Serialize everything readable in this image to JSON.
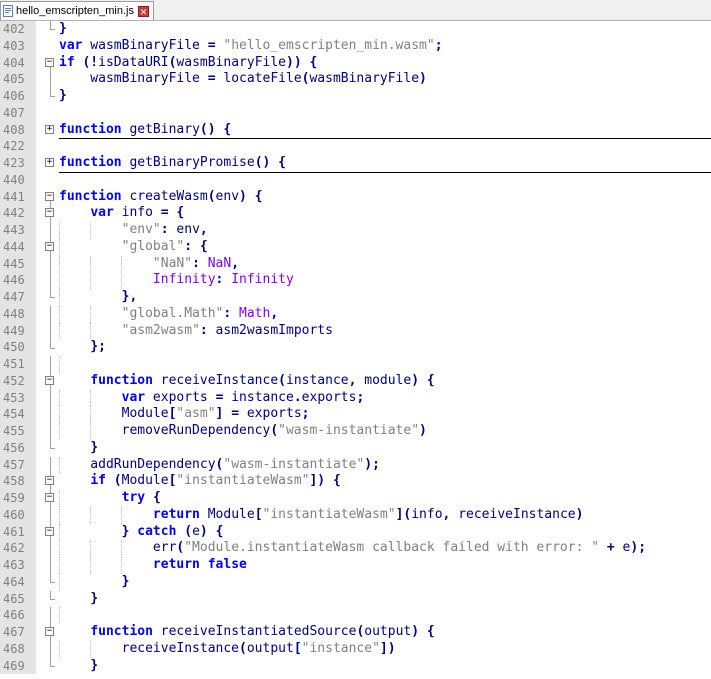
{
  "tab": {
    "filename": "hello_emscripten_min.js",
    "icon": "file-icon",
    "close_icon": "close-icon"
  },
  "colors": {
    "keyword": "#0000ff",
    "string": "#808080",
    "identifier": "#000080",
    "special": "#8000ff",
    "gutter": "#e4e4e4"
  },
  "lines": [
    {
      "n": "402",
      "fold": "end",
      "indent": 0,
      "tokens": [
        {
          "t": "}",
          "c": "op"
        }
      ]
    },
    {
      "n": "403",
      "fold": "none",
      "indent": 0,
      "tokens": [
        {
          "t": "var",
          "c": "kw"
        },
        {
          "t": " wasmBinaryFile ",
          "c": "id"
        },
        {
          "t": "=",
          "c": "op"
        },
        {
          "t": " ",
          "c": "id"
        },
        {
          "t": "\"hello_emscripten_min.wasm\"",
          "c": "str"
        },
        {
          "t": ";",
          "c": "op"
        }
      ]
    },
    {
      "n": "404",
      "fold": "open",
      "indent": 0,
      "tokens": [
        {
          "t": "if",
          "c": "kw"
        },
        {
          "t": " ",
          "c": "id"
        },
        {
          "t": "(!",
          "c": "op"
        },
        {
          "t": "isDataURI",
          "c": "id"
        },
        {
          "t": "(",
          "c": "op"
        },
        {
          "t": "wasmBinaryFile",
          "c": "id"
        },
        {
          "t": "))",
          "c": "op"
        },
        {
          "t": " ",
          "c": "id"
        },
        {
          "t": "{",
          "c": "op"
        }
      ]
    },
    {
      "n": "405",
      "fold": "mid",
      "indent": 0,
      "tokens": [
        {
          "t": "    wasmBinaryFile ",
          "c": "id"
        },
        {
          "t": "=",
          "c": "op"
        },
        {
          "t": " locateFile",
          "c": "id"
        },
        {
          "t": "(",
          "c": "op"
        },
        {
          "t": "wasmBinaryFile",
          "c": "id"
        },
        {
          "t": ")",
          "c": "op"
        }
      ]
    },
    {
      "n": "406",
      "fold": "end",
      "indent": 0,
      "tokens": [
        {
          "t": "}",
          "c": "op"
        }
      ]
    },
    {
      "n": "407",
      "fold": "none",
      "indent": 0,
      "tokens": []
    },
    {
      "n": "408",
      "fold": "closed",
      "foldline": true,
      "indent": 0,
      "tokens": [
        {
          "t": "function",
          "c": "kw"
        },
        {
          "t": " getBinary",
          "c": "id"
        },
        {
          "t": "()",
          "c": "op"
        },
        {
          "t": " ",
          "c": "id"
        },
        {
          "t": "{",
          "c": "op"
        }
      ]
    },
    {
      "n": "422",
      "fold": "none",
      "indent": 0,
      "tokens": []
    },
    {
      "n": "423",
      "fold": "closed",
      "foldline": true,
      "indent": 0,
      "tokens": [
        {
          "t": "function",
          "c": "kw"
        },
        {
          "t": " getBinaryPromise",
          "c": "id"
        },
        {
          "t": "()",
          "c": "op"
        },
        {
          "t": " ",
          "c": "id"
        },
        {
          "t": "{",
          "c": "op"
        }
      ]
    },
    {
      "n": "440",
      "fold": "none",
      "indent": 0,
      "tokens": []
    },
    {
      "n": "441",
      "fold": "open",
      "indent": 0,
      "tokens": [
        {
          "t": "function",
          "c": "kw"
        },
        {
          "t": " createWasm",
          "c": "id"
        },
        {
          "t": "(",
          "c": "op"
        },
        {
          "t": "env",
          "c": "id"
        },
        {
          "t": ")",
          "c": "op"
        },
        {
          "t": " ",
          "c": "id"
        },
        {
          "t": "{",
          "c": "op"
        }
      ]
    },
    {
      "n": "442",
      "fold": "open",
      "indent": 1,
      "tokens": [
        {
          "t": "    ",
          "c": "id"
        },
        {
          "t": "var",
          "c": "kw"
        },
        {
          "t": " info ",
          "c": "id"
        },
        {
          "t": "=",
          "c": "op"
        },
        {
          "t": " ",
          "c": "id"
        },
        {
          "t": "{",
          "c": "op"
        }
      ]
    },
    {
      "n": "443",
      "fold": "mid",
      "indent": 2,
      "tokens": [
        {
          "t": "        ",
          "c": "id"
        },
        {
          "t": "\"env\"",
          "c": "str"
        },
        {
          "t": ":",
          "c": "op"
        },
        {
          "t": " env",
          "c": "id"
        },
        {
          "t": ",",
          "c": "op"
        }
      ]
    },
    {
      "n": "444",
      "fold": "open",
      "indent": 2,
      "tokens": [
        {
          "t": "        ",
          "c": "id"
        },
        {
          "t": "\"global\"",
          "c": "str"
        },
        {
          "t": ":",
          "c": "op"
        },
        {
          "t": " ",
          "c": "id"
        },
        {
          "t": "{",
          "c": "op"
        }
      ]
    },
    {
      "n": "445",
      "fold": "mid",
      "indent": 3,
      "tokens": [
        {
          "t": "            ",
          "c": "id"
        },
        {
          "t": "\"NaN\"",
          "c": "str"
        },
        {
          "t": ":",
          "c": "op"
        },
        {
          "t": " ",
          "c": "id"
        },
        {
          "t": "NaN",
          "c": "sp"
        },
        {
          "t": ",",
          "c": "op"
        }
      ]
    },
    {
      "n": "446",
      "fold": "mid",
      "indent": 3,
      "tokens": [
        {
          "t": "            ",
          "c": "id"
        },
        {
          "t": "Infinity",
          "c": "sp"
        },
        {
          "t": ":",
          "c": "op"
        },
        {
          "t": " ",
          "c": "id"
        },
        {
          "t": "Infinity",
          "c": "sp"
        }
      ]
    },
    {
      "n": "447",
      "fold": "end",
      "indent": 2,
      "tokens": [
        {
          "t": "        ",
          "c": "id"
        },
        {
          "t": "},",
          "c": "op"
        }
      ]
    },
    {
      "n": "448",
      "fold": "mid",
      "indent": 2,
      "tokens": [
        {
          "t": "        ",
          "c": "id"
        },
        {
          "t": "\"global.Math\"",
          "c": "str"
        },
        {
          "t": ":",
          "c": "op"
        },
        {
          "t": " ",
          "c": "id"
        },
        {
          "t": "Math",
          "c": "sp"
        },
        {
          "t": ",",
          "c": "op"
        }
      ]
    },
    {
      "n": "449",
      "fold": "mid",
      "indent": 2,
      "tokens": [
        {
          "t": "        ",
          "c": "id"
        },
        {
          "t": "\"asm2wasm\"",
          "c": "str"
        },
        {
          "t": ":",
          "c": "op"
        },
        {
          "t": " asm2wasmImports",
          "c": "id"
        }
      ]
    },
    {
      "n": "450",
      "fold": "end",
      "indent": 1,
      "tokens": [
        {
          "t": "    ",
          "c": "id"
        },
        {
          "t": "};",
          "c": "op"
        }
      ]
    },
    {
      "n": "451",
      "fold": "mid",
      "indent": 1,
      "tokens": []
    },
    {
      "n": "452",
      "fold": "open",
      "indent": 1,
      "tokens": [
        {
          "t": "    ",
          "c": "id"
        },
        {
          "t": "function",
          "c": "kw"
        },
        {
          "t": " receiveInstance",
          "c": "id"
        },
        {
          "t": "(",
          "c": "op"
        },
        {
          "t": "instance",
          "c": "id"
        },
        {
          "t": ",",
          "c": "op"
        },
        {
          "t": " module",
          "c": "id"
        },
        {
          "t": ")",
          "c": "op"
        },
        {
          "t": " ",
          "c": "id"
        },
        {
          "t": "{",
          "c": "op"
        }
      ]
    },
    {
      "n": "453",
      "fold": "mid",
      "indent": 2,
      "tokens": [
        {
          "t": "        ",
          "c": "id"
        },
        {
          "t": "var",
          "c": "kw"
        },
        {
          "t": " exports ",
          "c": "id"
        },
        {
          "t": "=",
          "c": "op"
        },
        {
          "t": " instance",
          "c": "id"
        },
        {
          "t": ".",
          "c": "op"
        },
        {
          "t": "exports",
          "c": "id"
        },
        {
          "t": ";",
          "c": "op"
        }
      ]
    },
    {
      "n": "454",
      "fold": "mid",
      "indent": 2,
      "tokens": [
        {
          "t": "        Module",
          "c": "id"
        },
        {
          "t": "[",
          "c": "op"
        },
        {
          "t": "\"asm\"",
          "c": "str"
        },
        {
          "t": "]",
          "c": "op"
        },
        {
          "t": " ",
          "c": "id"
        },
        {
          "t": "=",
          "c": "op"
        },
        {
          "t": " exports",
          "c": "id"
        },
        {
          "t": ";",
          "c": "op"
        }
      ]
    },
    {
      "n": "455",
      "fold": "mid",
      "indent": 2,
      "tokens": [
        {
          "t": "        removeRunDependency",
          "c": "id"
        },
        {
          "t": "(",
          "c": "op"
        },
        {
          "t": "\"wasm-instantiate\"",
          "c": "str"
        },
        {
          "t": ")",
          "c": "op"
        }
      ]
    },
    {
      "n": "456",
      "fold": "end",
      "indent": 1,
      "tokens": [
        {
          "t": "    ",
          "c": "id"
        },
        {
          "t": "}",
          "c": "op"
        }
      ]
    },
    {
      "n": "457",
      "fold": "mid",
      "indent": 1,
      "tokens": [
        {
          "t": "    addRunDependency",
          "c": "id"
        },
        {
          "t": "(",
          "c": "op"
        },
        {
          "t": "\"wasm-instantiate\"",
          "c": "str"
        },
        {
          "t": ");",
          "c": "op"
        }
      ]
    },
    {
      "n": "458",
      "fold": "open",
      "indent": 1,
      "tokens": [
        {
          "t": "    ",
          "c": "id"
        },
        {
          "t": "if",
          "c": "kw"
        },
        {
          "t": " ",
          "c": "id"
        },
        {
          "t": "(",
          "c": "op"
        },
        {
          "t": "Module",
          "c": "id"
        },
        {
          "t": "[",
          "c": "op"
        },
        {
          "t": "\"instantiateWasm\"",
          "c": "str"
        },
        {
          "t": "])",
          "c": "op"
        },
        {
          "t": " ",
          "c": "id"
        },
        {
          "t": "{",
          "c": "op"
        }
      ]
    },
    {
      "n": "459",
      "fold": "open",
      "indent": 2,
      "tokens": [
        {
          "t": "        ",
          "c": "id"
        },
        {
          "t": "try",
          "c": "kw"
        },
        {
          "t": " ",
          "c": "id"
        },
        {
          "t": "{",
          "c": "op"
        }
      ]
    },
    {
      "n": "460",
      "fold": "mid",
      "indent": 3,
      "tokens": [
        {
          "t": "            ",
          "c": "id"
        },
        {
          "t": "return",
          "c": "kw"
        },
        {
          "t": " Module",
          "c": "id"
        },
        {
          "t": "[",
          "c": "op"
        },
        {
          "t": "\"instantiateWasm\"",
          "c": "str"
        },
        {
          "t": "](",
          "c": "op"
        },
        {
          "t": "info",
          "c": "id"
        },
        {
          "t": ",",
          "c": "op"
        },
        {
          "t": " receiveInstance",
          "c": "id"
        },
        {
          "t": ")",
          "c": "op"
        }
      ]
    },
    {
      "n": "461",
      "fold": "open",
      "indent": 2,
      "tokens": [
        {
          "t": "        ",
          "c": "id"
        },
        {
          "t": "}",
          "c": "op"
        },
        {
          "t": " ",
          "c": "id"
        },
        {
          "t": "catch",
          "c": "kw"
        },
        {
          "t": " ",
          "c": "id"
        },
        {
          "t": "(",
          "c": "op"
        },
        {
          "t": "e",
          "c": "id"
        },
        {
          "t": ")",
          "c": "op"
        },
        {
          "t": " ",
          "c": "id"
        },
        {
          "t": "{",
          "c": "op"
        }
      ]
    },
    {
      "n": "462",
      "fold": "mid",
      "indent": 3,
      "tokens": [
        {
          "t": "            err",
          "c": "id"
        },
        {
          "t": "(",
          "c": "op"
        },
        {
          "t": "\"Module.instantiateWasm callback failed with error: \"",
          "c": "str"
        },
        {
          "t": " ",
          "c": "id"
        },
        {
          "t": "+",
          "c": "op"
        },
        {
          "t": " e",
          "c": "id"
        },
        {
          "t": ");",
          "c": "op"
        }
      ]
    },
    {
      "n": "463",
      "fold": "mid",
      "indent": 3,
      "tokens": [
        {
          "t": "            ",
          "c": "id"
        },
        {
          "t": "return",
          "c": "kw"
        },
        {
          "t": " ",
          "c": "id"
        },
        {
          "t": "false",
          "c": "kw"
        }
      ]
    },
    {
      "n": "464",
      "fold": "end",
      "indent": 2,
      "tokens": [
        {
          "t": "        ",
          "c": "id"
        },
        {
          "t": "}",
          "c": "op"
        }
      ]
    },
    {
      "n": "465",
      "fold": "end",
      "indent": 1,
      "tokens": [
        {
          "t": "    ",
          "c": "id"
        },
        {
          "t": "}",
          "c": "op"
        }
      ]
    },
    {
      "n": "466",
      "fold": "mid",
      "indent": 1,
      "tokens": []
    },
    {
      "n": "467",
      "fold": "open",
      "indent": 1,
      "tokens": [
        {
          "t": "    ",
          "c": "id"
        },
        {
          "t": "function",
          "c": "kw"
        },
        {
          "t": " receiveInstantiatedSource",
          "c": "id"
        },
        {
          "t": "(",
          "c": "op"
        },
        {
          "t": "output",
          "c": "id"
        },
        {
          "t": ")",
          "c": "op"
        },
        {
          "t": " ",
          "c": "id"
        },
        {
          "t": "{",
          "c": "op"
        }
      ]
    },
    {
      "n": "468",
      "fold": "mid",
      "indent": 2,
      "tokens": [
        {
          "t": "        receiveInstance",
          "c": "id"
        },
        {
          "t": "(",
          "c": "op"
        },
        {
          "t": "output",
          "c": "id"
        },
        {
          "t": "[",
          "c": "op"
        },
        {
          "t": "\"instance\"",
          "c": "str"
        },
        {
          "t": "])",
          "c": "op"
        }
      ]
    },
    {
      "n": "469",
      "fold": "end",
      "indent": 1,
      "tokens": [
        {
          "t": "    ",
          "c": "id"
        },
        {
          "t": "}",
          "c": "op"
        }
      ]
    }
  ]
}
